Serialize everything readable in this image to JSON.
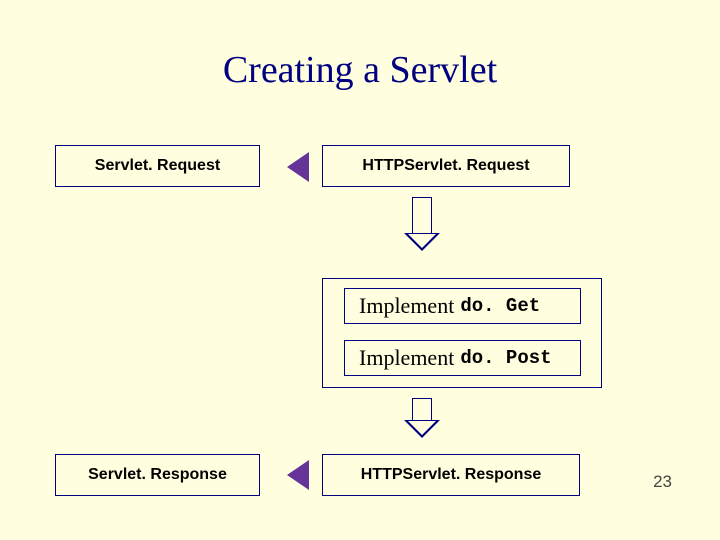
{
  "title": "Creating a Servlet",
  "page_number": "23",
  "colors": {
    "background": "#ffffe0",
    "border": "#000080",
    "accent": "#663399",
    "title": "#000080"
  },
  "boxes": {
    "servlet_request": "Servlet. Request",
    "http_servlet_request": "HTTPServlet. Request",
    "servlet_response": "Servlet. Response",
    "http_servlet_response": "HTTPServlet. Response"
  },
  "impl": {
    "prefix": "Implement ",
    "do_get": "do. Get",
    "do_post": "do. Post"
  }
}
